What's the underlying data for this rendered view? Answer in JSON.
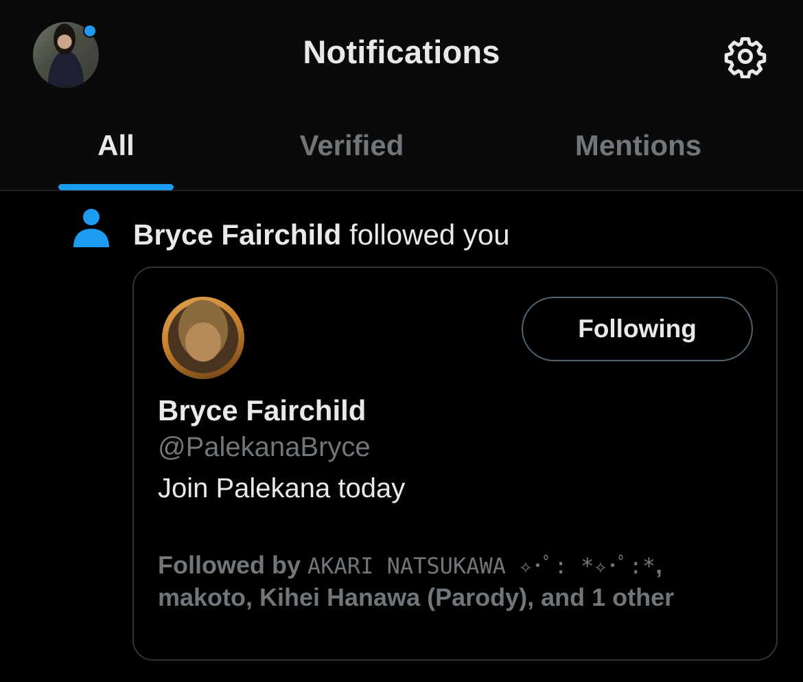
{
  "header": {
    "title": "Notifications",
    "has_unread_dot": true
  },
  "tabs": [
    {
      "label": "All",
      "active": true
    },
    {
      "label": "Verified",
      "active": false
    },
    {
      "label": "Mentions",
      "active": false
    }
  ],
  "notification": {
    "icon": "person-icon",
    "actor_name": "Bryce Fairchild",
    "action_text": " followed you",
    "card": {
      "follow_button_label": "Following",
      "display_name": "Bryce Fairchild",
      "handle": "@PalekanaBryce",
      "bio": "Join Palekana today",
      "followed_by_prefix": "Followed by ",
      "followed_by_styled": "AKARI NATSUKAWA ✧･ﾟ: *✧･ﾟ:*",
      "followed_by_rest": ", makoto, Kihei Hanawa (Parody), and 1 other"
    }
  },
  "colors": {
    "accent": "#1d9bf0",
    "background": "#000000",
    "header_bg": "#0a0a0a",
    "text_primary": "#e7e9ea",
    "text_secondary": "#71767b",
    "border": "#2f3336"
  }
}
